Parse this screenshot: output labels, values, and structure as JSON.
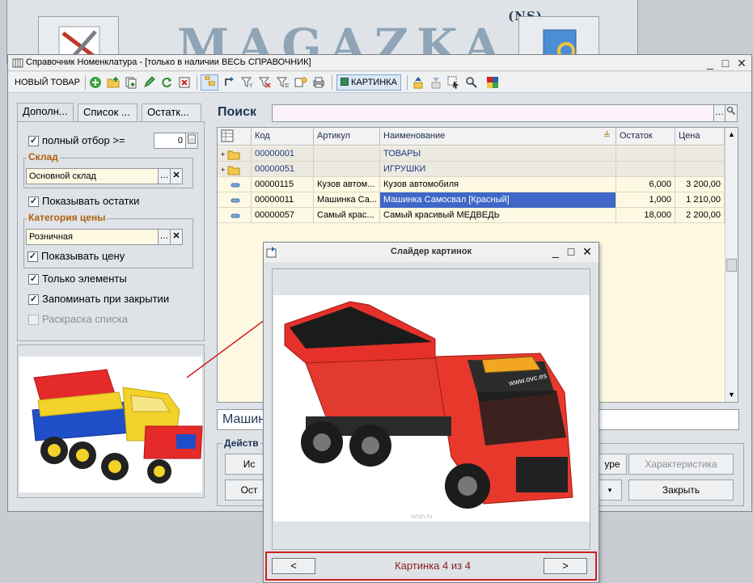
{
  "background_app": {
    "logo_text": "MAGAZKA",
    "logo_sup": "(NS)"
  },
  "window": {
    "title": "Справочник Номенклатура - [только в наличии ВЕСЬ СПРАВОЧНИК]",
    "controls": [
      "_",
      "□",
      "✕"
    ]
  },
  "toolbar": {
    "new_item_label": "НОВЫЙ ТОВАР",
    "pictures_label": "КАРТИНКА"
  },
  "tabs": [
    "Дополн...",
    "Список ...",
    "Остатк..."
  ],
  "left_panel": {
    "full_select_label": "полный отбор >=",
    "full_select_checked": true,
    "full_select_value": "0",
    "warehouse_group": "Склад",
    "warehouse_value": "Основной склад",
    "show_stock_label": "Показывать остатки",
    "show_stock_checked": true,
    "price_group": "Категория цены",
    "price_value": "Розничная",
    "show_price_label": "Показывать цену",
    "show_price_checked": true,
    "only_elements_label": "Только элементы",
    "only_elements_checked": true,
    "remember_label": "Запоминать при закрытии",
    "remember_checked": true,
    "coloring_label": "Раскраска списка",
    "coloring_checked": false
  },
  "search": {
    "label": "Поиск",
    "value": ""
  },
  "grid": {
    "columns": [
      "Код",
      "Артикул",
      "Наименование",
      "Остаток",
      "Цена"
    ],
    "rows": [
      {
        "type": "folder",
        "code": "00000001",
        "article": "",
        "name": "ТОВАРЫ",
        "stock": "",
        "price": ""
      },
      {
        "type": "folder",
        "code": "00000051",
        "article": "",
        "name": "ИГРУШКИ",
        "stock": "",
        "price": ""
      },
      {
        "type": "item",
        "code": "00000115",
        "article": "Кузов автом...",
        "name": "Кузов автомобиля",
        "stock": "6,000",
        "price": "3 200,00"
      },
      {
        "type": "item",
        "code": "00000011",
        "article": "Машинка Са...",
        "name": "Машинка Самосвал [Красный]",
        "stock": "1,000",
        "price": "1 210,00",
        "selected": true
      },
      {
        "type": "item",
        "code": "00000057",
        "article": "Самый крас...",
        "name": "Самый красивый МЕДВЕДЬ",
        "stock": "18,000",
        "price": "2 200,00"
      }
    ]
  },
  "name_bar": "Машин",
  "actions": {
    "group_label": "Действ",
    "btn1": "Ис",
    "btn2": "Ост",
    "btn3": "уре",
    "characteristic": "Характеристика",
    "close": "Закрыть"
  },
  "slider": {
    "title": "Слайдер картинок",
    "prev": "<",
    "next": ">",
    "counter": "Картинка 4 из 4",
    "watermark": "ozon.ru",
    "truck_text": "www.ovc.es"
  },
  "colors": {
    "selection": "#3e67c7",
    "annotation": "#d11f1f",
    "field_yellow": "#fdf9e3"
  }
}
